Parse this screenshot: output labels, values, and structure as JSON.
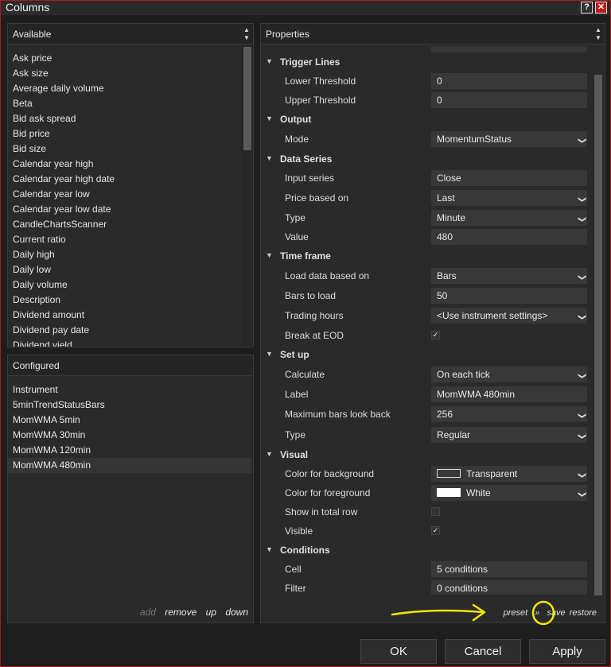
{
  "window": {
    "title": "Columns",
    "help_label": "?",
    "close_label": "✕"
  },
  "available": {
    "header": "Available",
    "items": [
      "Ask price",
      "Ask size",
      "Average daily volume",
      "Beta",
      "Bid ask spread",
      "Bid price",
      "Bid size",
      "Calendar year high",
      "Calendar year high date",
      "Calendar year low",
      "Calendar year low date",
      "CandleChartsScanner",
      "Current ratio",
      "Daily high",
      "Daily low",
      "Daily volume",
      "Description",
      "Dividend amount",
      "Dividend pay date",
      "Dividend yield"
    ]
  },
  "configured": {
    "header": "Configured",
    "items": [
      "Instrument",
      "5minTrendStatusBars",
      "MomWMA 5min",
      "MomWMA 30min",
      "MomWMA 120min",
      "MomWMA 480min"
    ],
    "selected_index": 5,
    "actions": {
      "add": "add",
      "remove": "remove",
      "up": "up",
      "down": "down"
    }
  },
  "properties": {
    "header": "Properties",
    "rows": [
      {
        "kind": "cat",
        "label": "Trigger Lines"
      },
      {
        "kind": "text",
        "label": "Lower Threshold",
        "value": "0"
      },
      {
        "kind": "text",
        "label": "Upper Threshold",
        "value": "0"
      },
      {
        "kind": "cat",
        "label": "Output"
      },
      {
        "kind": "select",
        "label": "Mode",
        "value": "MomentumStatus"
      },
      {
        "kind": "cat",
        "label": "Data Series"
      },
      {
        "kind": "text",
        "label": "Input series",
        "value": "Close"
      },
      {
        "kind": "select",
        "label": "Price based on",
        "value": "Last"
      },
      {
        "kind": "select",
        "label": "Type",
        "value": "Minute"
      },
      {
        "kind": "text",
        "label": "Value",
        "value": "480"
      },
      {
        "kind": "cat",
        "label": "Time frame"
      },
      {
        "kind": "select",
        "label": "Load data based on",
        "value": "Bars"
      },
      {
        "kind": "text",
        "label": "Bars to load",
        "value": "50"
      },
      {
        "kind": "select",
        "label": "Trading hours",
        "value": "<Use instrument settings>"
      },
      {
        "kind": "check",
        "label": "Break at EOD",
        "checked": true
      },
      {
        "kind": "cat",
        "label": "Set up"
      },
      {
        "kind": "select",
        "label": "Calculate",
        "value": "On each tick"
      },
      {
        "kind": "text",
        "label": "Label",
        "value": "MomWMA 480min"
      },
      {
        "kind": "select",
        "label": "Maximum bars look back",
        "value": "256"
      },
      {
        "kind": "select",
        "label": "Type",
        "value": "Regular"
      },
      {
        "kind": "cat",
        "label": "Visual"
      },
      {
        "kind": "color",
        "label": "Color for background",
        "value": "Transparent",
        "swatch": "transparent"
      },
      {
        "kind": "color",
        "label": "Color for foreground",
        "value": "White",
        "swatch": "#ffffff"
      },
      {
        "kind": "check",
        "label": "Show in total row",
        "checked": false
      },
      {
        "kind": "check",
        "label": "Visible",
        "checked": true
      },
      {
        "kind": "cat",
        "label": "Conditions"
      },
      {
        "kind": "text",
        "label": "Cell",
        "value": "5 conditions"
      },
      {
        "kind": "text",
        "label": "Filter",
        "value": "0 conditions"
      }
    ],
    "footer": {
      "preset": "preset",
      "sep": "»",
      "save": "save",
      "restore": "restore"
    }
  },
  "buttons": {
    "ok": "OK",
    "cancel": "Cancel",
    "apply": "Apply"
  },
  "colors": {
    "window_border": "#b01818",
    "annotation": "#f2e600"
  }
}
